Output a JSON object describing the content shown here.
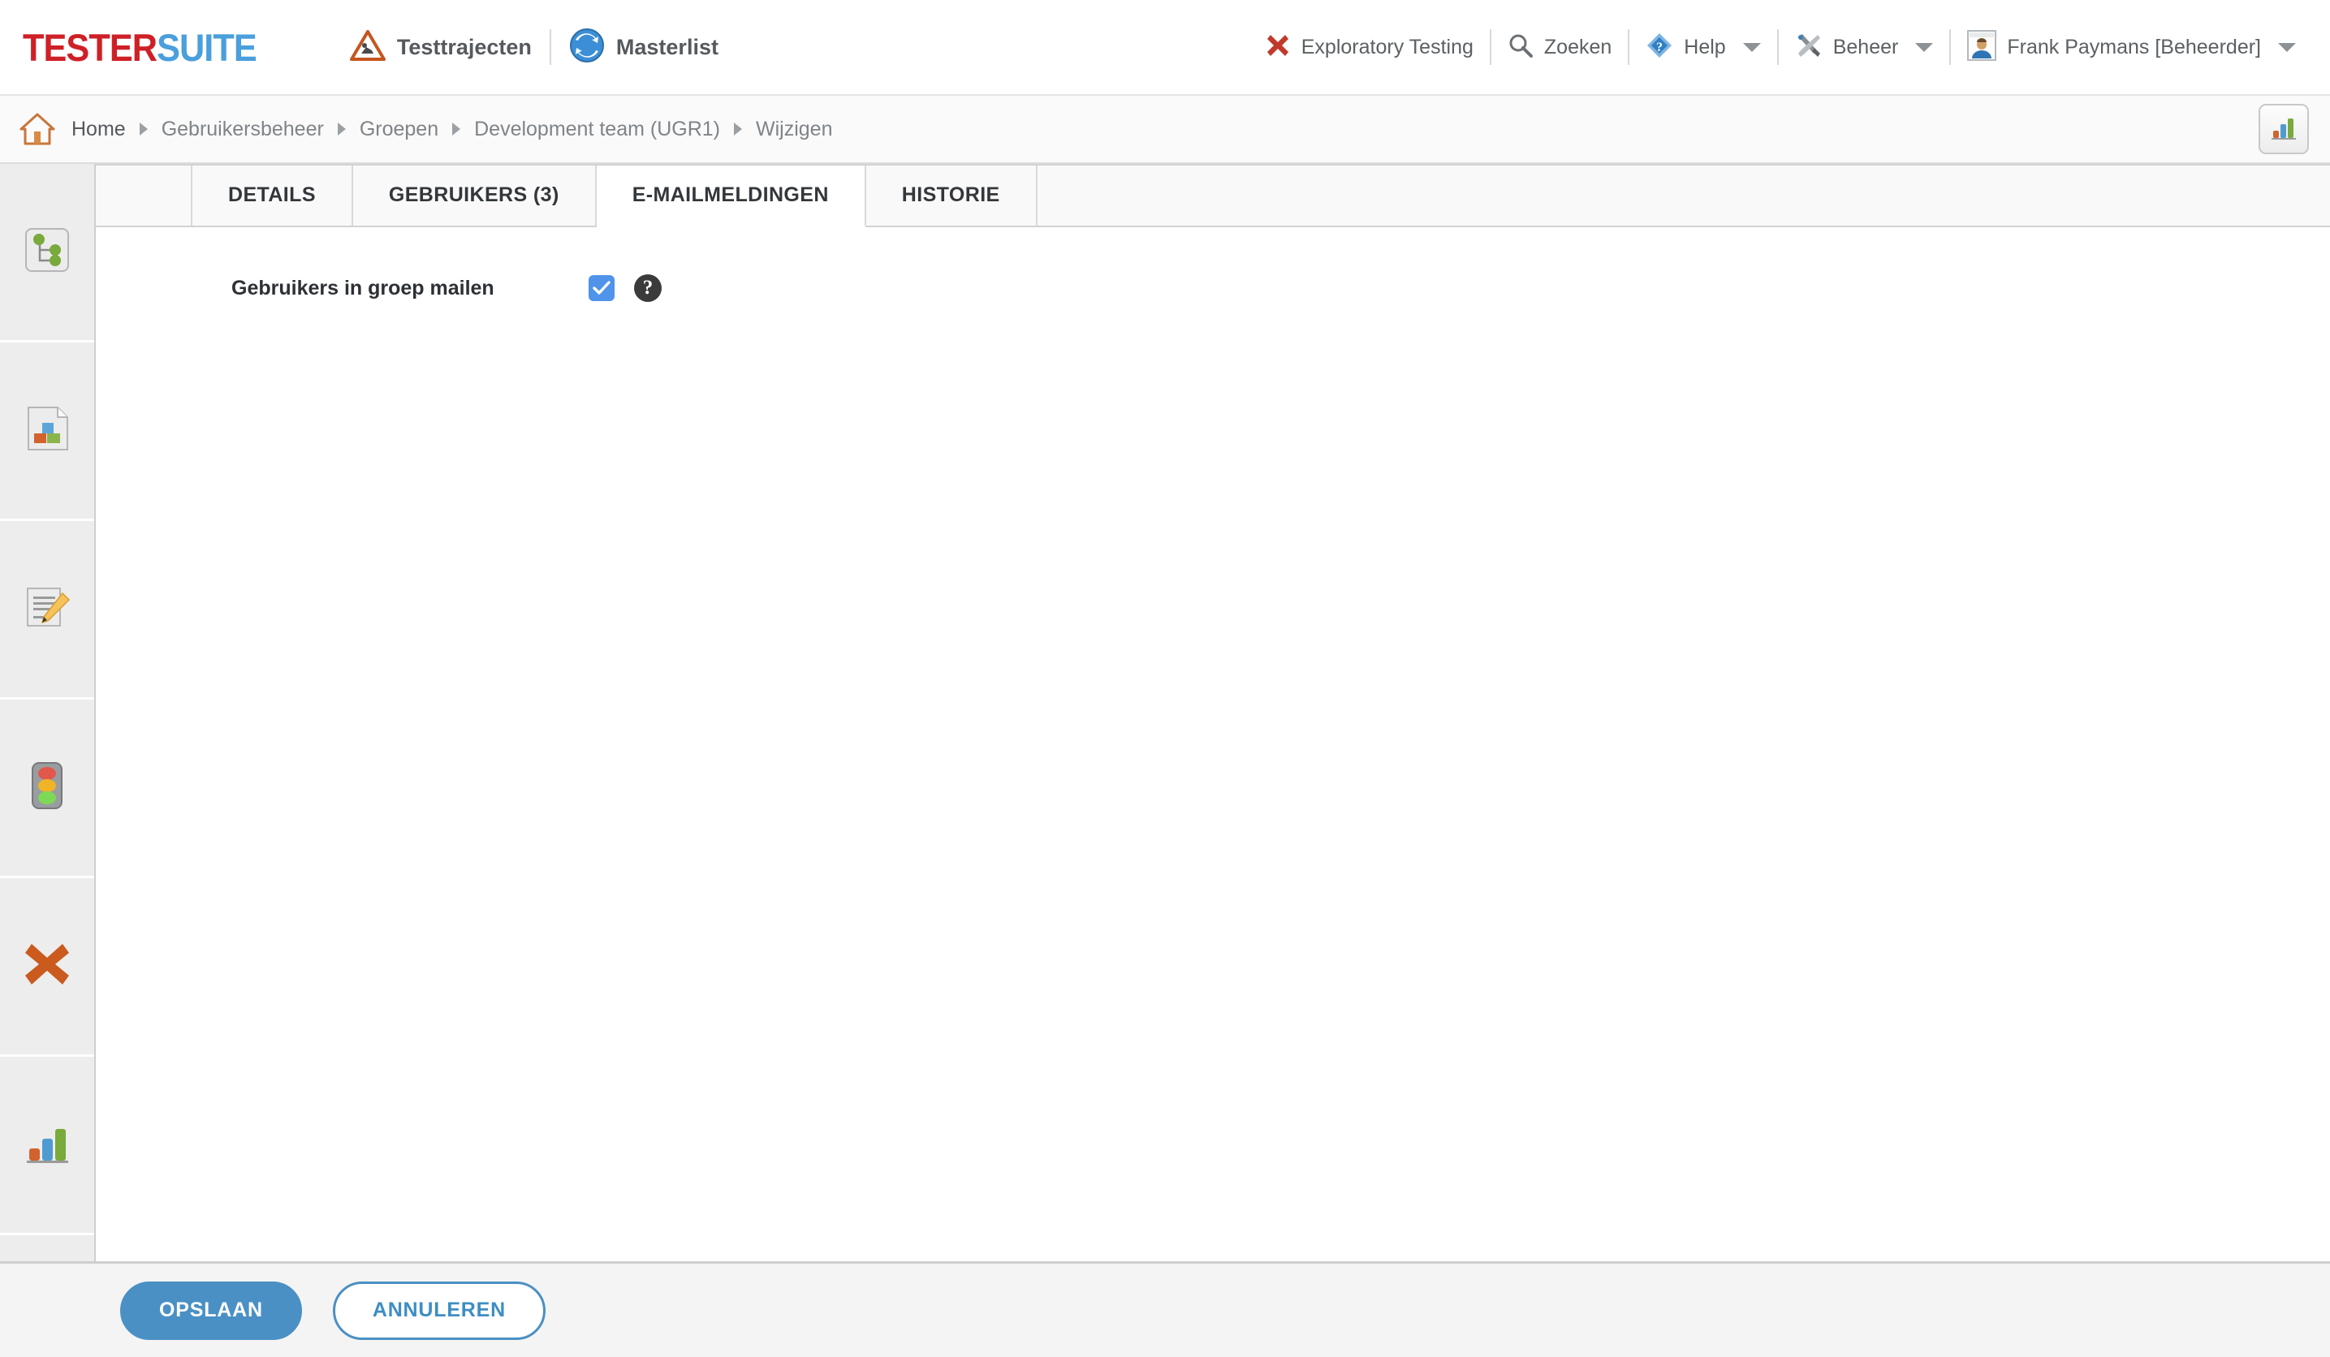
{
  "brand": {
    "part1": "TESTER",
    "part2": "SUITE"
  },
  "appnav": [
    {
      "label": "Testtrajecten",
      "icon": "roadworks-warning-icon"
    },
    {
      "label": "Masterlist",
      "icon": "sync-globe-icon"
    }
  ],
  "rightnav": [
    {
      "label": "Exploratory Testing",
      "icon": "red-x-icon",
      "caret": false
    },
    {
      "label": "Zoeken",
      "icon": "search-icon",
      "caret": false
    },
    {
      "label": "Help",
      "icon": "help-diamond-icon",
      "caret": true
    },
    {
      "label": "Beheer",
      "icon": "tools-icon",
      "caret": true
    },
    {
      "label": "Frank Paymans [Beheerder]",
      "icon": "user-avatar-icon",
      "caret": true
    }
  ],
  "breadcrumb": {
    "home_icon": "home-icon",
    "items": [
      "Home",
      "Gebruikersbeheer",
      "Groepen",
      "Development team (UGR1)",
      "Wijzigen"
    ],
    "chart_button_icon": "bar-chart-icon"
  },
  "sidebar": {
    "items": [
      {
        "icon": "hierarchy-tree-icon",
        "name": "sidebar-item-hierarchy"
      },
      {
        "icon": "building-blocks-document-icon",
        "name": "sidebar-item-modules"
      },
      {
        "icon": "document-edit-icon",
        "name": "sidebar-item-edit"
      },
      {
        "icon": "traffic-light-icon",
        "name": "sidebar-item-status"
      },
      {
        "icon": "orange-x-icon",
        "name": "sidebar-item-defects"
      },
      {
        "icon": "bar-chart-icon",
        "name": "sidebar-item-reports"
      }
    ]
  },
  "tabs": [
    {
      "label": "DETAILS",
      "active": false
    },
    {
      "label": "GEBRUIKERS (3)",
      "active": false
    },
    {
      "label": "E-MAILMELDINGEN",
      "active": true
    },
    {
      "label": "HISTORIE",
      "active": false
    }
  ],
  "form": {
    "mail_users_label": "Gebruikers in groep mailen",
    "mail_users_checked": true,
    "help_glyph": "?"
  },
  "footer": {
    "save_label": "OPSLAAN",
    "cancel_label": "ANNULEREN"
  },
  "colors": {
    "brand_red": "#cf2027",
    "brand_blue": "#4a9fdc",
    "accent_blue": "#4a90c4",
    "checkbox_blue": "#4f93ea",
    "sidebar_bg": "#ededed"
  }
}
